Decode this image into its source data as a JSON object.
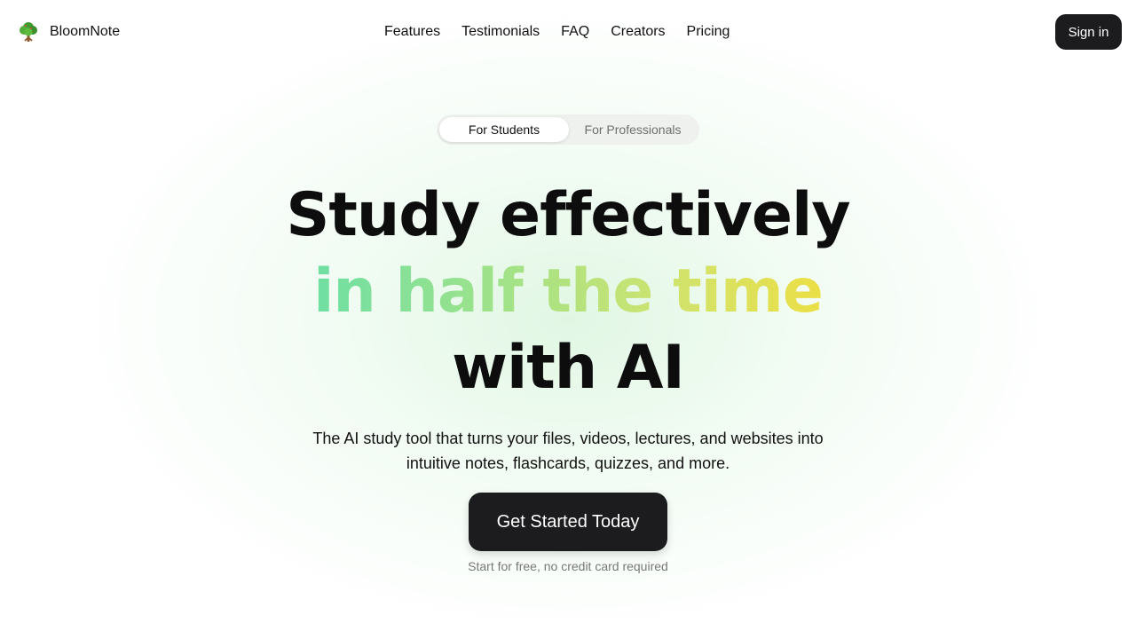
{
  "header": {
    "brand_name": "BloomNote",
    "logo_icon": "tree-icon",
    "nav": [
      {
        "label": "Features"
      },
      {
        "label": "Testimonials"
      },
      {
        "label": "FAQ"
      },
      {
        "label": "Creators"
      },
      {
        "label": "Pricing"
      }
    ],
    "signin_label": "Sign in"
  },
  "audience_toggle": {
    "options": [
      {
        "label": "For Students",
        "selected": true
      },
      {
        "label": "For Professionals",
        "selected": false
      }
    ]
  },
  "hero": {
    "line1": "Study effectively",
    "line2": "in half the time",
    "line3": "with AI",
    "subtitle": "The AI study tool that turns your files, videos, lectures, and websites into intuitive notes, flashcards, quizzes, and more.",
    "cta_label": "Get Started Today",
    "cta_note": "Start for free, no credit card required"
  },
  "colors": {
    "accent_dark": "#1c1c1e",
    "gradient_start": "#6fdfa3",
    "gradient_end": "#ecdf45",
    "background_glow": "#d7f5dc"
  }
}
